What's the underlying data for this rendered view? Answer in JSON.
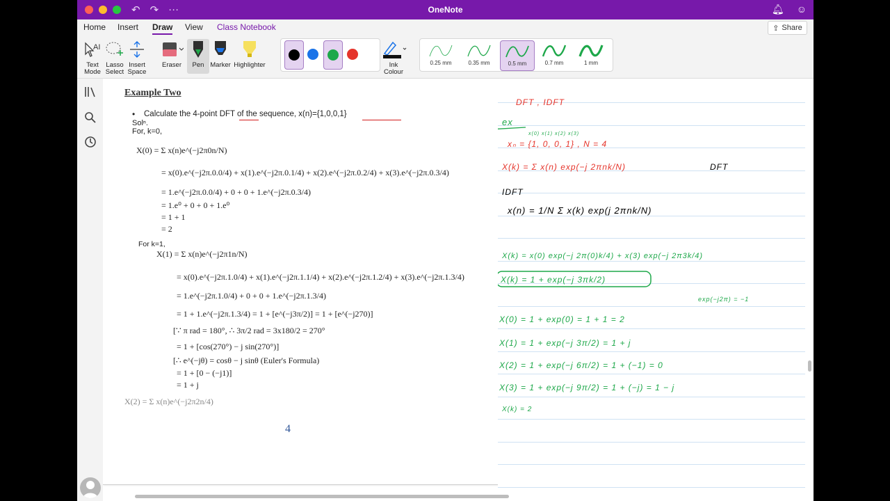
{
  "window": {
    "app_title": "OneNote",
    "accent": "#7719aa"
  },
  "menu": {
    "items": [
      {
        "label": "Home"
      },
      {
        "label": "Insert"
      },
      {
        "label": "Draw"
      },
      {
        "label": "View"
      },
      {
        "label": "Class Notebook"
      }
    ],
    "active": "Draw",
    "share_label": "Share"
  },
  "ribbon": {
    "text_mode": [
      "Text",
      "Mode"
    ],
    "lasso_select": [
      "Lasso",
      "Select"
    ],
    "insert_space": [
      "Insert",
      "Space"
    ],
    "eraser": "Eraser",
    "pen": "Pen",
    "marker": "Marker",
    "highlighter": "Highlighter",
    "ink_colour": [
      "Ink",
      "Colour"
    ],
    "pen_colors": [
      "#000000",
      "#1a73e8",
      "#1ea84a",
      "#e5342b"
    ],
    "selected_pens": [
      0,
      2
    ],
    "thicknesses": [
      {
        "label": "0.25 mm"
      },
      {
        "label": "0.35 mm"
      },
      {
        "label": "0.5 mm"
      },
      {
        "label": "0.7 mm"
      },
      {
        "label": "1 mm"
      }
    ],
    "selected_thickness": "0.5 mm"
  },
  "document": {
    "heading": "Example Two",
    "bullet_pre": "Calculate the 4-point ",
    "bullet_dft": "DFT",
    "bullet_mid": " of the sequence, x(n)=",
    "bullet_seq": "{1,0,0,1}",
    "sol": "Solⁿ.",
    "for_k0": "For, k=0,",
    "k0_lines": [
      "X(0) = Σ x(n)e^(−j2π0n/N)",
      "= x(0).e^(−j2π.0.0/4) + x(1).e^(−j2π.0.1/4) + x(2).e^(−j2π.0.2/4) + x(3).e^(−j2π.0.3/4)",
      "= 1.e^(−j2π.0.0/4) + 0 + 0 + 1.e^(−j2π.0.3/4)",
      "= 1.e⁰ + 0 + 0 + 1.e⁰",
      "= 1 + 1",
      "= 2"
    ],
    "for_k1": "For k=1,",
    "k1_lines": [
      "X(1) = Σ x(n)e^(−j2π1n/N)",
      "= x(0).e^(−j2π.1.0/4) + x(1).e^(−j2π.1.1/4) + x(2).e^(−j2π.1.2/4) + x(3).e^(−j2π.1.3/4)",
      "= 1.e^(−j2π.1.0/4) + 0 + 0 + 1.e^(−j2π.1.3/4)",
      "= 1 + 1.e^(−j2π.1.3/4) = 1 + [e^(−j3π/2)] = 1 + [e^(−j270)]",
      "[∵ π rad = 180°, ∴ 3π/2 rad = 3x180/2 = 270°",
      "= 1 + [cos(270°) − j sin(270°)]",
      "[∴ e^(−jθ) = cosθ − j sinθ (Euler's Formula)",
      "= 1 + [0 − (−j1)]",
      "= 1 + j"
    ],
    "x2_line": "X(2) = Σ x(n)e^(−j2π2n/4)",
    "page_number": "4"
  },
  "notes": {
    "line1": "DFT , IDFT",
    "ex": "ex",
    "seq_labels": "x(0) x(1) x(2) x(3)",
    "seq": "xₙ = {1, 0, 0, 1} , N = 4",
    "dft_formula": "X(k) = Σ x(n) exp(−j 2πnk/N)",
    "dft_label": "DFT",
    "idft_heading": "IDFT",
    "idft_formula": "x(n) = 1/N Σ x(k) exp(j 2πnk/N)",
    "expand": "X(k) = x(0) exp(−j 2π(0)k/4) + x(3) exp(−j 2π3k/4)",
    "boxed": "X(k) = 1 + exp(−j 3πk/2)",
    "side": "exp(−j2π) = −1",
    "x0": "X(0) = 1 + exp(0) = 1 + 1 = 2",
    "x1": "X(1) = 1 + exp(−j 3π/2) = 1 + j",
    "x2": "X(2) = 1 + exp(−j 6π/2) = 1 + (−1) = 0",
    "x3": "X(3) = 1 + exp(−j 9π/2) = 1 + (−j) = 1 − j",
    "last": "X(k) = 2"
  }
}
